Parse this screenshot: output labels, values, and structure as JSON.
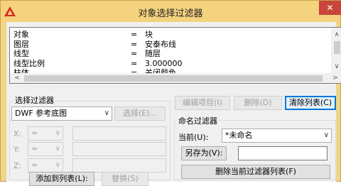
{
  "window": {
    "title": "对象选择过滤器",
    "close_glyph": "✕"
  },
  "list": {
    "rows": [
      {
        "key": "对象",
        "eq": "=",
        "value": "块"
      },
      {
        "key": "图层",
        "eq": "=",
        "value": "安泰布线"
      },
      {
        "key": "线型",
        "eq": "=",
        "value": "随层"
      },
      {
        "key": "线型比例",
        "eq": "=",
        "value": "3.000000"
      },
      {
        "key": "柱体",
        "eq": "=",
        "value": "关闭颜色"
      }
    ],
    "scroll_up": "∧",
    "scroll_down": "∨",
    "scroll_left": "<",
    "scroll_right": ">"
  },
  "actions": {
    "edit_item": "编辑项目(I)",
    "delete": "删除(D)",
    "clear_list": "清除列表(C)"
  },
  "select_filter": {
    "label": "选择过滤器",
    "type_value": "DWF 参考底图",
    "select_button": "选择(E)...",
    "x_label": "X:",
    "y_label": "Y:",
    "z_label": "Z:",
    "op_value": "=",
    "add_to_list": "添加到列表(L):",
    "replace": "替换(S)"
  },
  "named_filter": {
    "label": "命名过滤器",
    "current_label": "当前(U):",
    "current_value": "*未命名",
    "save_as": "另存为(V):",
    "save_as_value": "",
    "delete_current": "删除当前过滤器列表(F)"
  },
  "colors": {
    "title_bar": "#f4d27e",
    "frame": "#f0d48a",
    "close_button": "#c9453a",
    "focus": "#0078d7"
  },
  "icons": [
    "app-logo-icon",
    "close-icon",
    "chevron-down-icon",
    "scroll-up-icon",
    "scroll-down-icon",
    "scroll-left-icon",
    "scroll-right-icon"
  ]
}
